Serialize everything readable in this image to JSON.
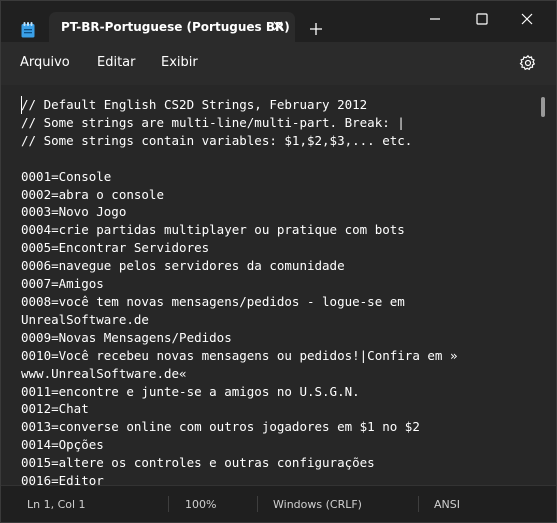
{
  "tab": {
    "title": "PT-BR-Portuguese (Portugues BR)"
  },
  "menu": {
    "items": [
      "Arquivo",
      "Editar",
      "Exibir"
    ]
  },
  "editor": {
    "lines": [
      "// Default English CS2D Strings, February 2012",
      "// Some strings are multi-line/multi-part. Break: |",
      "// Some strings contain variables: $1,$2,$3,... etc.",
      "",
      "0001=Console",
      "0002=abra o console",
      "0003=Novo Jogo",
      "0004=crie partidas multiplayer ou pratique com bots",
      "0005=Encontrar Servidores",
      "0006=navegue pelos servidores da comunidade",
      "0007=Amigos",
      "0008=você tem novas mensagens/pedidos - logue-se em",
      "UnrealSoftware.de",
      "0009=Novas Mensagens/Pedidos",
      "0010=Você recebeu novas mensagens ou pedidos!|Confira em »",
      "www.UnrealSoftware.de«",
      "0011=encontre e junte-se a amigos no U.S.G.N.",
      "0012=Chat",
      "0013=converse online com outros jogadores em $1 no $2",
      "0014=Opções",
      "0015=altere os controles e outras configurações",
      "0016=Editor"
    ]
  },
  "status": {
    "position": "Ln 1, Col 1",
    "zoom": "100%",
    "line_ending": "Windows (CRLF)",
    "encoding": "ANSI"
  },
  "icons": {
    "app": "notepad-icon",
    "tab_close": "close-icon",
    "new_tab": "plus-icon",
    "minimize": "minimize-icon",
    "maximize": "maximize-icon",
    "close": "close-icon",
    "settings": "gear-icon"
  },
  "colors": {
    "app_icon": "#3aa0e8",
    "background": "#272727",
    "text": "#ffffff"
  }
}
